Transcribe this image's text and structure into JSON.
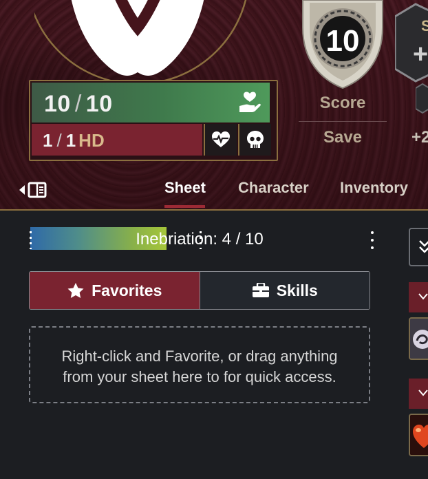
{
  "hp": {
    "current": "10",
    "max": "10",
    "separator": "/"
  },
  "hit_dice": {
    "current": "1",
    "max": "1",
    "separator": "/",
    "suffix": "HD"
  },
  "ac": {
    "value": "10",
    "score_label": "Score",
    "save_label": "Save",
    "save_value": "+2"
  },
  "hex_badge": {
    "letter": "S",
    "plus": "+"
  },
  "tabs": [
    {
      "label": "Sheet",
      "active": true
    },
    {
      "label": "Character",
      "active": false
    },
    {
      "label": "Inventory",
      "active": false
    }
  ],
  "meter": {
    "label": "Inebriation: 4 / 10",
    "value": 4,
    "max": 10
  },
  "segments": {
    "favorites": "Favorites",
    "skills": "Skills"
  },
  "favorites_empty": {
    "line1": "Right-click and Favorite, or drag anything",
    "line2": "from your sheet here to for quick access."
  },
  "colors": {
    "accent": "#7a2330",
    "gold_border": "#8b6f3f",
    "hp_green": "#3f7a4c",
    "bg": "#1c1e22"
  },
  "icons": [
    "heal-icon",
    "heartbeat-icon",
    "skull-icon",
    "sidebar-toggle-icon",
    "star-icon",
    "briefcase-icon",
    "kebab-menu-icon",
    "chevron-down-icon"
  ]
}
